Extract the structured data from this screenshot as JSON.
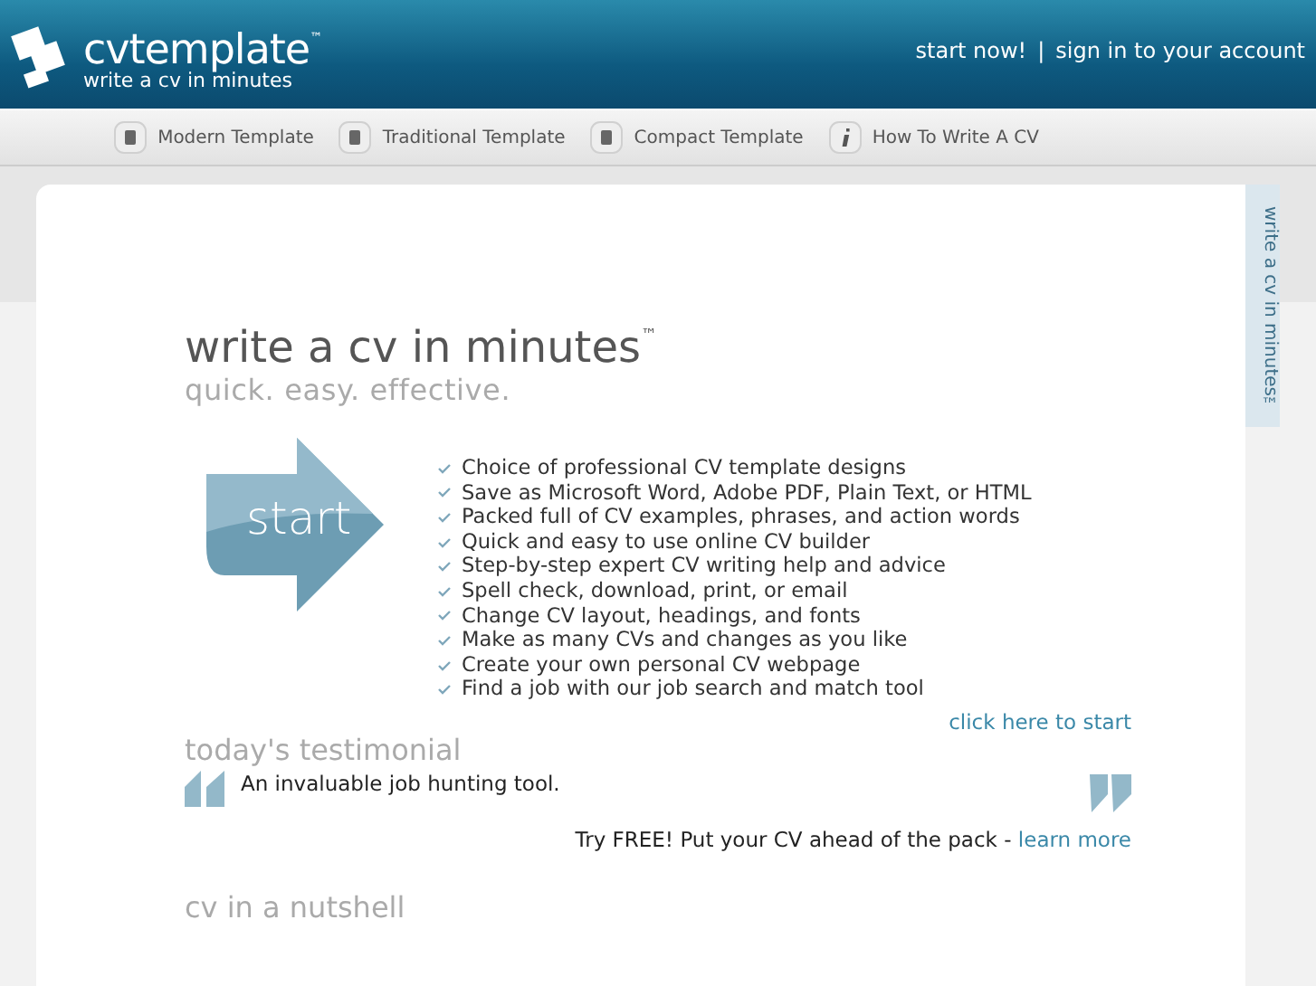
{
  "header": {
    "logo_name": "cvtemplate",
    "logo_tm": "™",
    "logo_tagline": "write a cv in minutes",
    "links": [
      "start now!",
      "sign in to your account"
    ],
    "separator": "|"
  },
  "nav": [
    {
      "label": "Modern Template",
      "kind": "document"
    },
    {
      "label": "Traditional Template",
      "kind": "document"
    },
    {
      "label": "Compact Template",
      "kind": "document"
    },
    {
      "label": "How To Write A CV",
      "kind": "info"
    }
  ],
  "side_tab": "write a cv in minutes™",
  "hero": {
    "title": "write a cv in minutes",
    "title_tm": "™",
    "subtitle": "quick. easy. effective.",
    "start_label": "start",
    "features": [
      "Choice of professional CV template designs",
      "Save as Microsoft Word, Adobe PDF, Plain Text, or HTML",
      "Packed full of CV examples, phrases, and action words",
      "Quick and easy to use online CV builder",
      "Step-by-step expert CV writing help and advice",
      "Spell check, download, print, or email",
      "Change CV layout, headings, and fonts",
      "Make as many CVs and changes as you like",
      "Create your own personal CV webpage",
      "Find a job with our job search and match tool"
    ],
    "cta": "click here to start"
  },
  "testimonial": {
    "heading": "today's testimonial",
    "quote": "An invaluable job hunting tool.",
    "promo": "Try FREE! Put your CV ahead of the pack -",
    "promo_link": "learn more"
  },
  "nutshell": {
    "heading": "cv in a nutshell"
  }
}
